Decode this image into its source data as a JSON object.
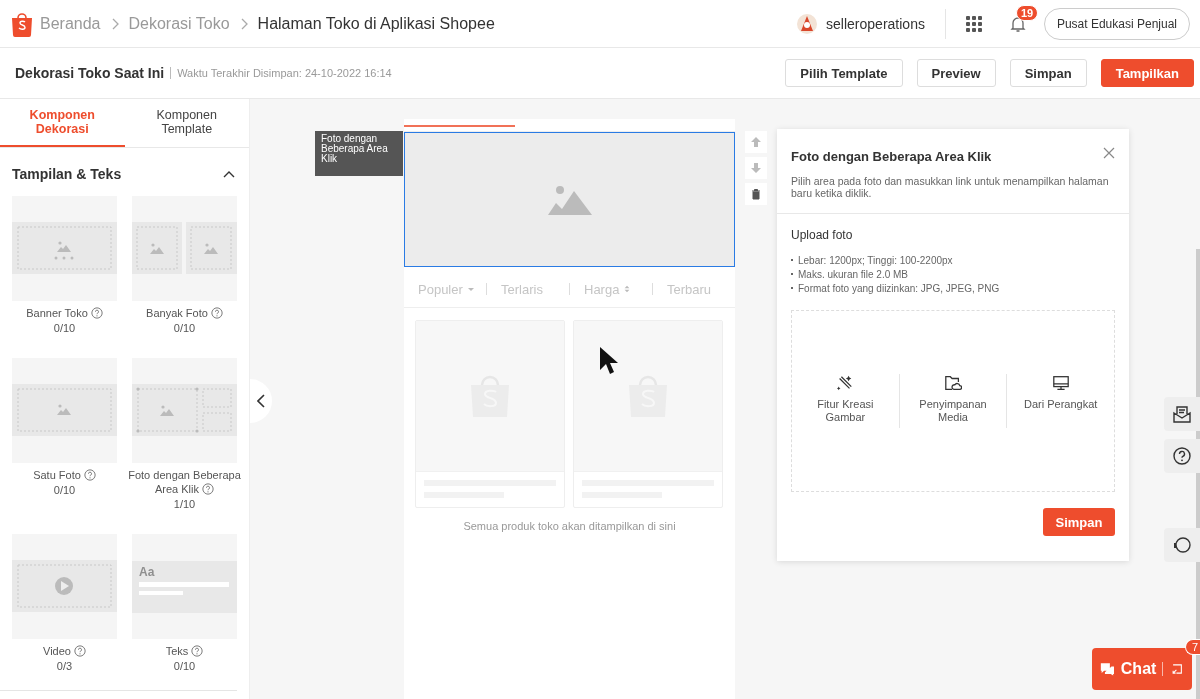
{
  "header": {
    "breadcrumbs": [
      {
        "label": "Beranda",
        "current": false
      },
      {
        "label": "Dekorasi Toko",
        "current": false
      },
      {
        "label": "Halaman Toko di Aplikasi Shopee",
        "current": true
      }
    ],
    "user": "selleroperations",
    "notification_count": "19",
    "help_button": "Pusat Edukasi Penjual"
  },
  "toolbar": {
    "title": "Dekorasi Toko Saat Ini",
    "saved_text": "Waktu Terakhir Disimpan: 24-10-2022 16:14",
    "buttons": [
      {
        "label": "Pilih Template",
        "kind": "outline"
      },
      {
        "label": "Preview",
        "kind": "outline"
      },
      {
        "label": "Simpan",
        "kind": "outline"
      },
      {
        "label": "Tampilkan",
        "kind": "primary"
      }
    ]
  },
  "sidebar": {
    "tabs": [
      {
        "label": "Komponen Dekorasi",
        "selected": true
      },
      {
        "label": "Komponen Template",
        "selected": false
      }
    ],
    "section": {
      "title": "Tampilan & Teks",
      "expanded": true
    },
    "components": [
      {
        "name": "Banner Toko",
        "count": "0/10",
        "kind": "banner"
      },
      {
        "name": "Banyak Foto",
        "count": "0/10",
        "kind": "multi"
      },
      {
        "name": "Satu Foto",
        "count": "0/10",
        "kind": "single"
      },
      {
        "name": "Foto dengan Beberapa Area Klik",
        "count": "1/10",
        "kind": "hotspot"
      },
      {
        "name": "Video",
        "count": "0/3",
        "kind": "video"
      },
      {
        "name": "Teks",
        "count": "0/10",
        "kind": "text",
        "sample": "Aa"
      }
    ]
  },
  "canvas": {
    "tooltip": "Foto dengan Beberapa Area Klik",
    "sort_options": [
      {
        "label": "Populer",
        "kind": "dropdown"
      },
      {
        "label": "Terlaris",
        "kind": "plain"
      },
      {
        "label": "Harga",
        "kind": "sort"
      },
      {
        "label": "Terbaru",
        "kind": "plain"
      }
    ],
    "empty_caption": "Semua produk toko akan ditampilkan di sini"
  },
  "panel": {
    "title": "Foto dengan Beberapa Area Klik",
    "description": "Pilih area pada foto dan masukkan link untuk menampilkan halaman baru ketika diklik.",
    "upload_title": "Upload foto",
    "requirements": [
      "Lebar: 1200px; Tinggi: 100-2200px",
      "Maks. ukuran file 2.0 MB",
      "Format foto yang diizinkan: JPG, JPEG, PNG"
    ],
    "sources": [
      {
        "label": "Fitur Kreasi Gambar",
        "kind": "wand"
      },
      {
        "label": "Penyimpanan Media",
        "kind": "cloud"
      },
      {
        "label": "Dari Perangkat",
        "kind": "monitor"
      }
    ],
    "save_button": "Simpan"
  },
  "chat": {
    "label": "Chat",
    "badge": "7"
  }
}
